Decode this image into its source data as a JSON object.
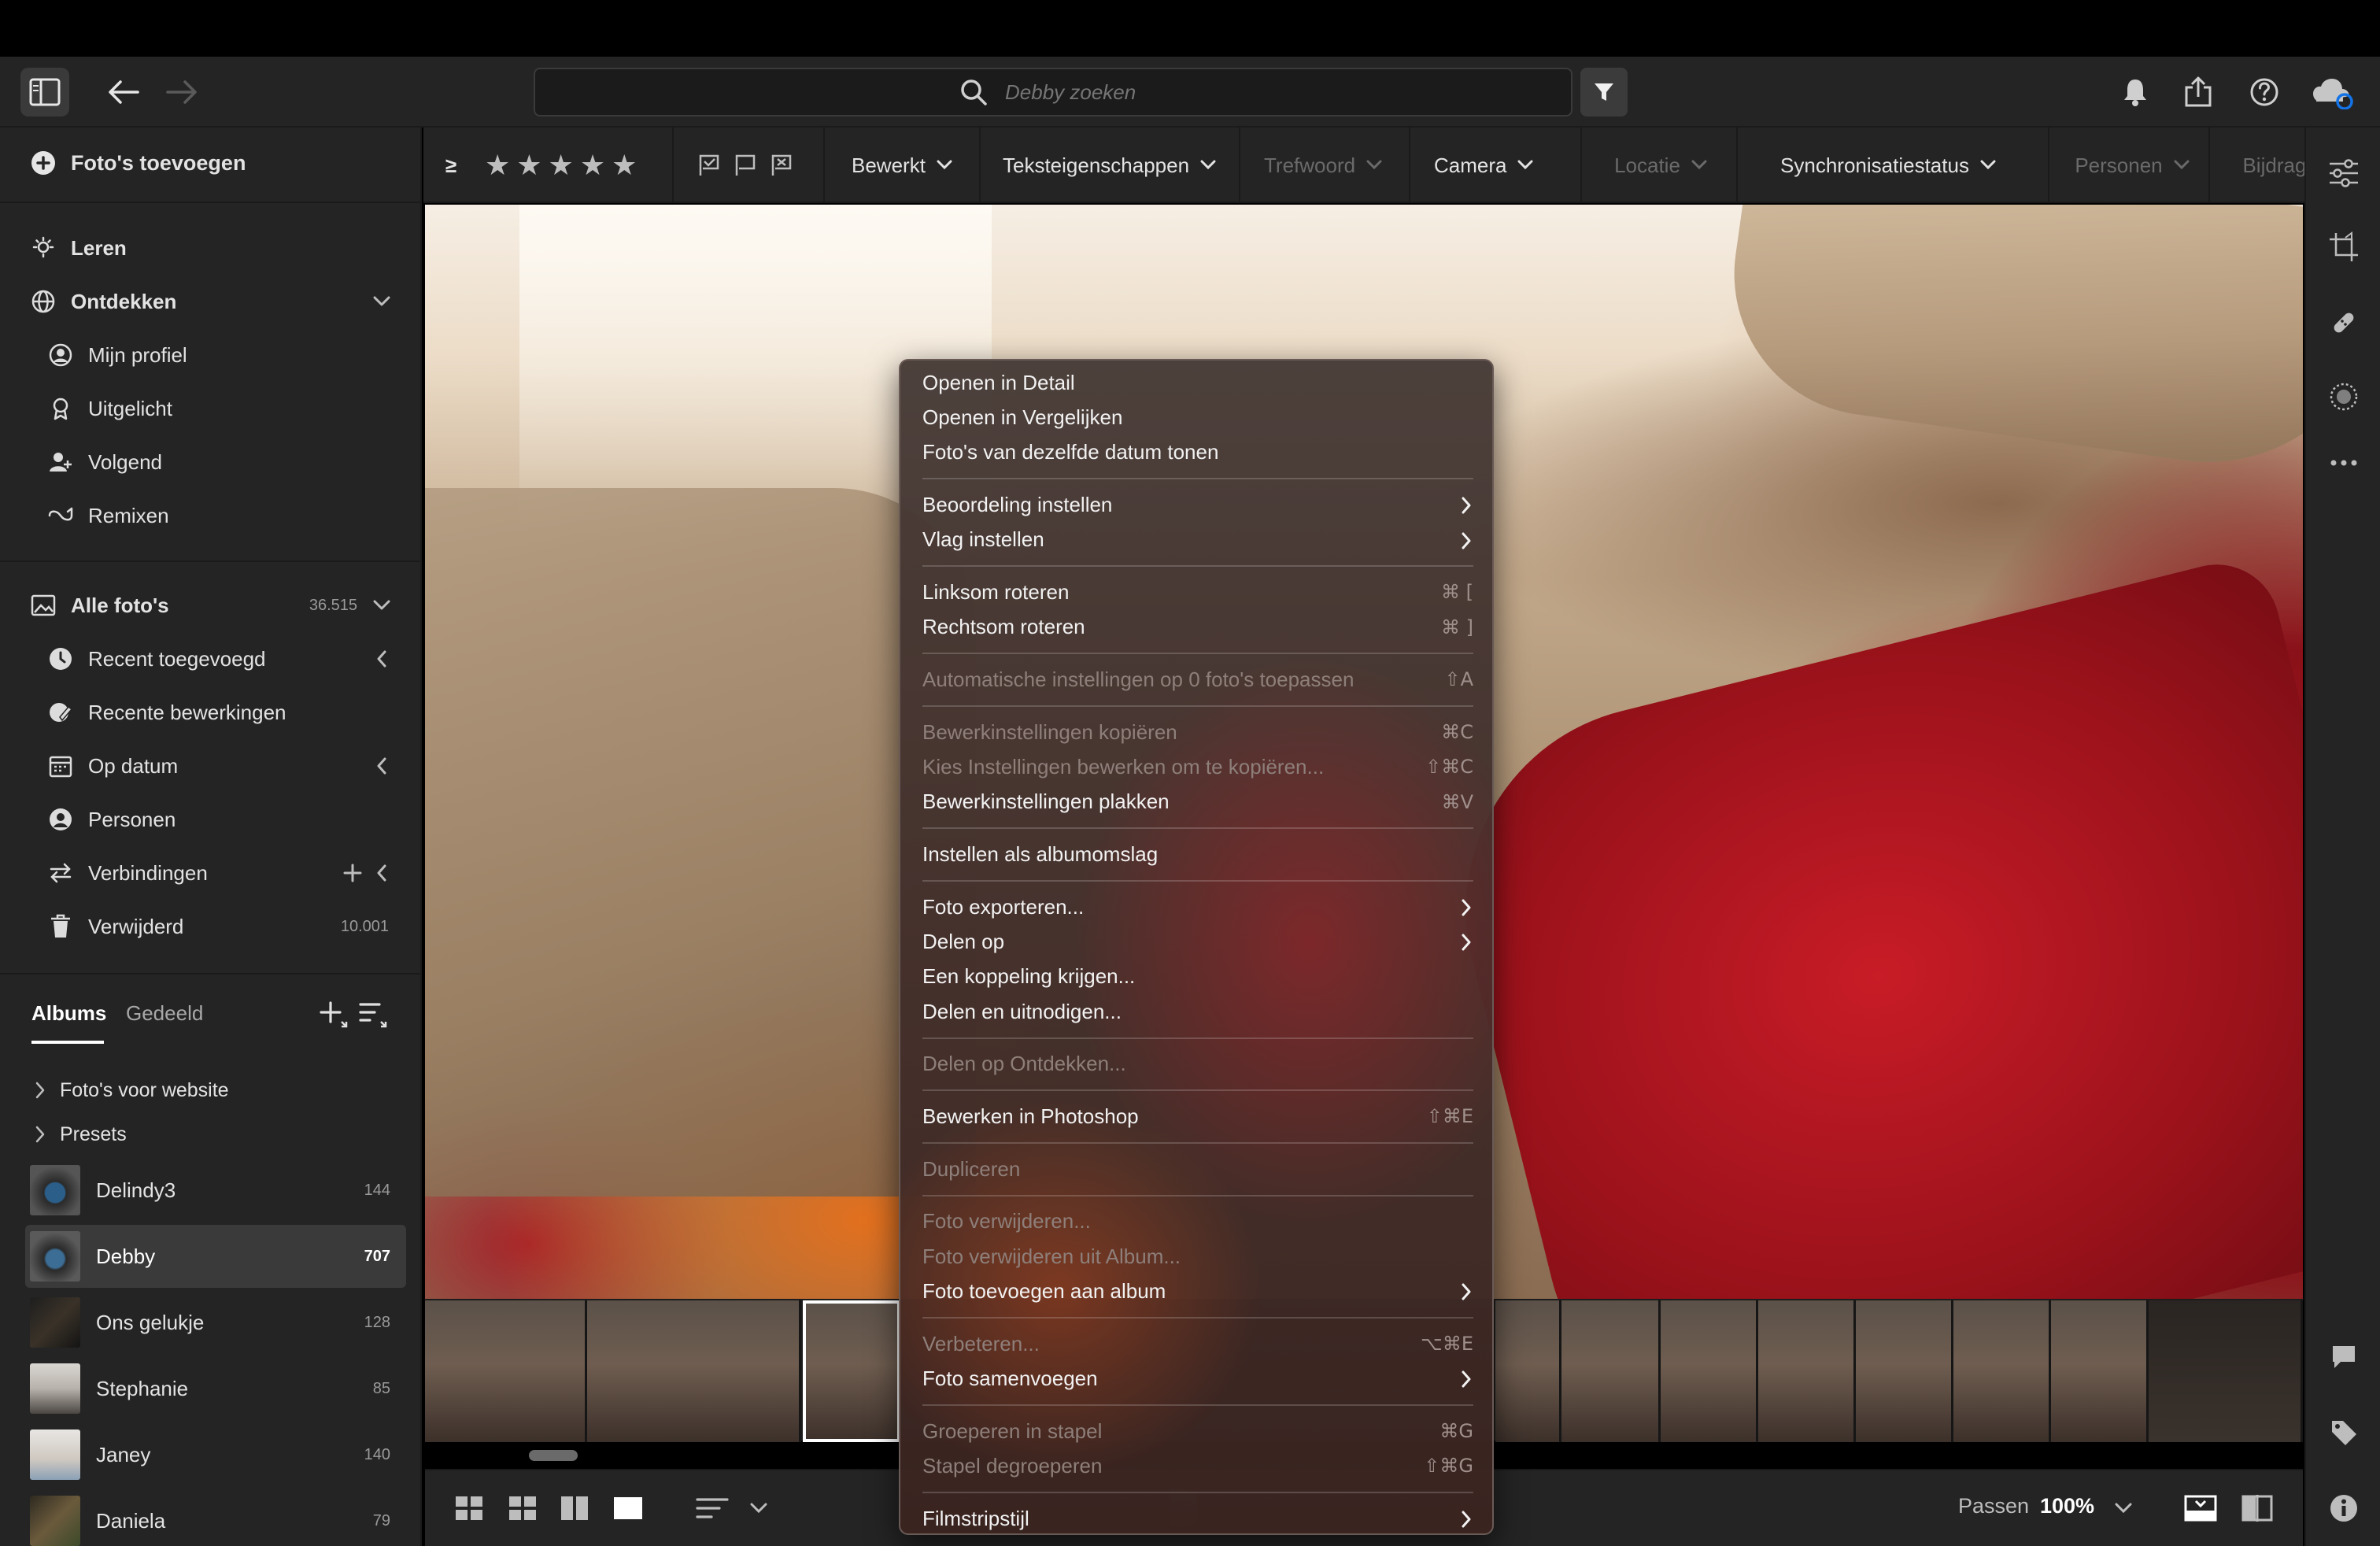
{
  "search": {
    "placeholder": "Debby zoeken"
  },
  "sidebar": {
    "add_photos": "Foto's toevoegen",
    "learn": "Leren",
    "discover": "Ontdekken",
    "discover_items": [
      "Mijn profiel",
      "Uitgelicht",
      "Volgend",
      "Remixen"
    ],
    "all_photos": {
      "label": "Alle foto's",
      "count": "36.515"
    },
    "library_items": [
      "Recent toegevoegd",
      "Recente bewerkingen",
      "Op datum",
      "Personen",
      "Verbindingen",
      "Verwijderd"
    ],
    "deleted_count": "10.001",
    "tabs": {
      "albums": "Albums",
      "shared": "Gedeeld"
    },
    "folders": [
      "Foto's voor website",
      "Presets"
    ],
    "albums": [
      {
        "name": "Delindy3",
        "count": "144"
      },
      {
        "name": "Debby",
        "count": "707",
        "selected": true
      },
      {
        "name": "Ons gelukje",
        "count": "128"
      },
      {
        "name": "Stephanie",
        "count": "85"
      },
      {
        "name": "Janey",
        "count": "140"
      },
      {
        "name": "Daniela",
        "count": "79"
      }
    ]
  },
  "filterbar": {
    "rating_operator": "≥",
    "stars": "★★★★★",
    "items": [
      {
        "label": "Bewerkt",
        "dim": false
      },
      {
        "label": "Teksteigenschappen",
        "dim": false
      },
      {
        "label": "Trefwoord",
        "dim": true
      },
      {
        "label": "Camera",
        "dim": false
      },
      {
        "label": "Locatie",
        "dim": true
      },
      {
        "label": "Synchronisatiestatus",
        "dim": false
      },
      {
        "label": "Personen",
        "dim": true
      },
      {
        "label": "Bijdragers",
        "dim": true
      }
    ]
  },
  "bottombar": {
    "fit_label": "Passen",
    "zoom": "100%"
  },
  "context_menu": {
    "items": [
      {
        "label": "Openen in Detail"
      },
      {
        "label": "Openen in Vergelijken"
      },
      {
        "label": "Foto's van dezelfde datum tonen"
      },
      {
        "label": "Beoordeling instellen",
        "submenu": true
      },
      {
        "label": "Vlag instellen",
        "submenu": true
      },
      {
        "label": "Linksom roteren",
        "shortcut": "⌘ ["
      },
      {
        "label": "Rechtsom roteren",
        "shortcut": "⌘ ]"
      },
      {
        "label": "Automatische instellingen op 0 foto's toepassen",
        "shortcut": "⇧A",
        "disabled": true
      },
      {
        "label": "Bewerkinstellingen kopiëren",
        "shortcut": "⌘C",
        "disabled": true
      },
      {
        "label": "Kies Instellingen bewerken om te kopiëren...",
        "shortcut": "⇧⌘C",
        "disabled": true
      },
      {
        "label": "Bewerkinstellingen plakken",
        "shortcut": "⌘V"
      },
      {
        "label": "Instellen als albumomslag"
      },
      {
        "label": "Foto exporteren...",
        "submenu": true
      },
      {
        "label": "Delen op",
        "submenu": true
      },
      {
        "label": "Een koppeling krijgen..."
      },
      {
        "label": "Delen en uitnodigen..."
      },
      {
        "label": "Delen op Ontdekken...",
        "disabled": true
      },
      {
        "label": "Bewerken in Photoshop",
        "shortcut": "⇧⌘E"
      },
      {
        "label": "Dupliceren",
        "disabled": true
      },
      {
        "label": "Foto verwijderen...",
        "disabled": true
      },
      {
        "label": "Foto verwijderen uit Album...",
        "disabled": true
      },
      {
        "label": "Foto toevoegen aan album",
        "submenu": true
      },
      {
        "label": "Verbeteren...",
        "shortcut": "⌥⌘E",
        "disabled": true
      },
      {
        "label": "Foto samenvoegen",
        "submenu": true
      },
      {
        "label": "Groeperen in stapel",
        "shortcut": "⌘G",
        "disabled": true
      },
      {
        "label": "Stapel degroeperen",
        "shortcut": "⇧⌘G",
        "disabled": true
      },
      {
        "label": "Filmstripstijl",
        "submenu": true
      }
    ]
  },
  "colors": {
    "background": "#242424",
    "accent_cloud": "#1473e6",
    "menu_bg": "#46302c"
  }
}
